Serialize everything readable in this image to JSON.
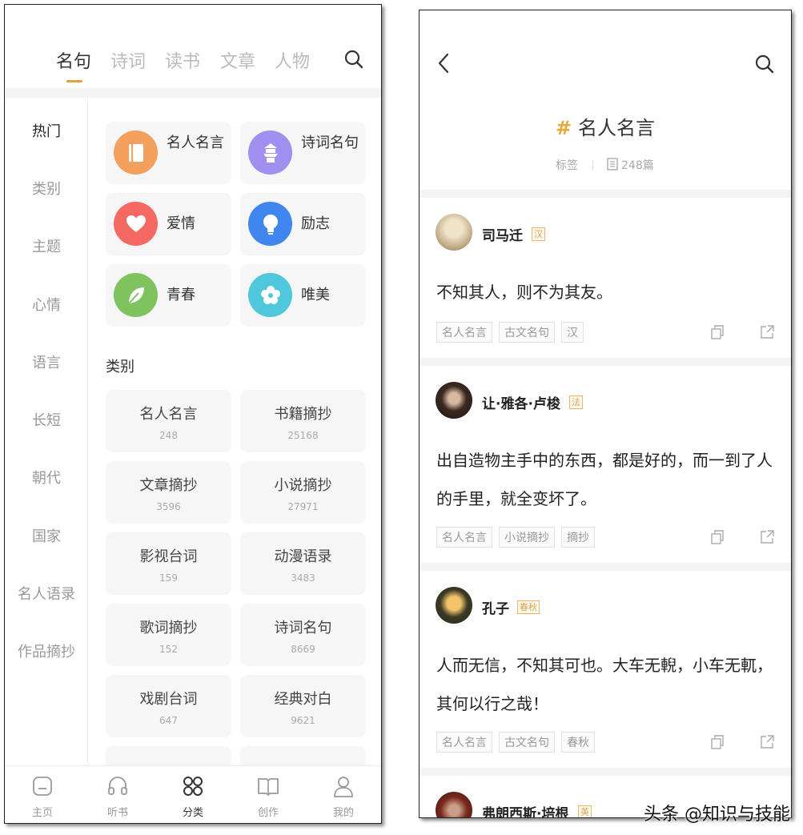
{
  "left": {
    "top_tabs": [
      "名句",
      "诗词",
      "读书",
      "文章",
      "人物"
    ],
    "sidebar": [
      "热门",
      "类别",
      "主题",
      "心情",
      "语言",
      "长短",
      "朝代",
      "国家",
      "名人语录",
      "作品摘抄"
    ],
    "feature_cards": [
      "名人名言",
      "诗词名句",
      "爱情",
      "励志",
      "青春",
      "唯美"
    ],
    "section_title": "类别",
    "categories": [
      {
        "name": "名人名言",
        "count": "248"
      },
      {
        "name": "书籍摘抄",
        "count": "25168"
      },
      {
        "name": "文章摘抄",
        "count": "3596"
      },
      {
        "name": "小说摘抄",
        "count": "27971"
      },
      {
        "name": "影视台词",
        "count": "159"
      },
      {
        "name": "动漫语录",
        "count": "3483"
      },
      {
        "name": "歌词摘抄",
        "count": "152"
      },
      {
        "name": "诗词名句",
        "count": "8669"
      },
      {
        "name": "戏剧台词",
        "count": "647"
      },
      {
        "name": "经典对白",
        "count": "9621"
      }
    ],
    "bottom_nav": [
      "主页",
      "听书",
      "分类",
      "创作",
      "我的"
    ]
  },
  "right": {
    "tag_hash": "#",
    "tag_name": "名人名言",
    "meta_label": "标签",
    "meta_count": "248篇",
    "quotes": [
      {
        "author": "司马迁",
        "era": "汉",
        "text": "不知其人，则不为其友。",
        "tags": [
          "名人名言",
          "古文名句",
          "汉"
        ]
      },
      {
        "author": "让·雅各·卢梭",
        "era": "法",
        "text": "出自造物主手中的东西，都是好的，而一到了人的手里，就全变坏了。",
        "tags": [
          "名人名言",
          "小说摘抄",
          "摘抄"
        ]
      },
      {
        "author": "孔子",
        "era": "春秋",
        "text": "人而无信，不知其可也。大车无輗，小车无軏，其何以行之哉！",
        "tags": [
          "名人名言",
          "古文名句",
          "春秋"
        ]
      },
      {
        "author": "弗朗西斯·培根",
        "era": "英",
        "text": "",
        "tags": []
      }
    ]
  },
  "watermark": "头条 @知识与技能",
  "colors": {
    "accent": "#e0a23b",
    "background": "#ffffff",
    "card": "#f6f6f6"
  }
}
